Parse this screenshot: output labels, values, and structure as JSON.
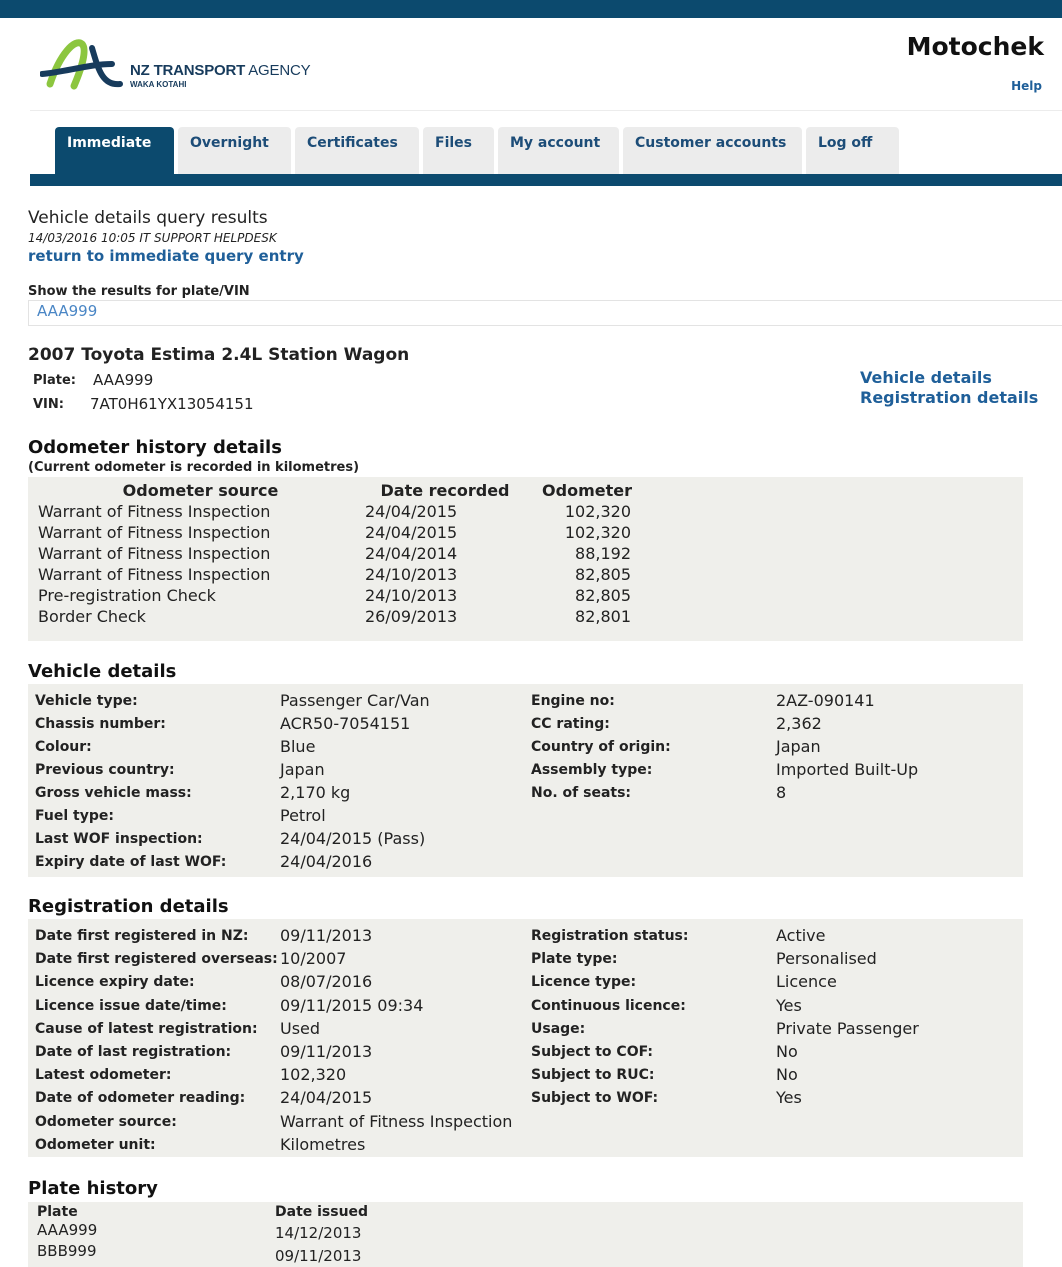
{
  "header": {
    "org_name_bold": "NZ TRANSPORT",
    "org_name_rest": " AGENCY",
    "org_sub": "WAKA KOTAHI",
    "app_name": "Motochek",
    "help": "Help"
  },
  "tabs": [
    {
      "label": "Immediate",
      "active": true
    },
    {
      "label": "Overnight"
    },
    {
      "label": "Certificates"
    },
    {
      "label": "Files"
    },
    {
      "label": "My account"
    },
    {
      "label": "Customer accounts"
    },
    {
      "label": "Log off"
    }
  ],
  "query": {
    "title": "Vehicle details query results",
    "subtitle": "14/03/2016 10:05 IT SUPPORT HELPDESK",
    "return_link": "return to immediate query entry",
    "show_label": "Show the results for plate/VIN",
    "plate_value": "AAA999"
  },
  "vehicle": {
    "title": "2007 Toyota Estima 2.4L Station Wagon",
    "plate_label": "Plate:",
    "plate": "AAA999",
    "vin_label": "VIN:",
    "vin": "7AT0H61YX13054151",
    "link_vehicle": "Vehicle details",
    "link_registration": "Registration details"
  },
  "odometer": {
    "title": "Odometer history details",
    "note": "(Current odometer is recorded in kilometres)",
    "headers": [
      "Odometer source",
      "Date recorded",
      "Odometer"
    ],
    "rows": [
      [
        "Warrant of Fitness Inspection",
        "24/04/2015",
        "102,320"
      ],
      [
        "Warrant of Fitness Inspection",
        "24/04/2015",
        "102,320"
      ],
      [
        "Warrant of Fitness Inspection",
        "24/04/2014",
        "88,192"
      ],
      [
        "Warrant of Fitness Inspection",
        "24/10/2013",
        "82,805"
      ],
      [
        "Pre-registration Check",
        "24/10/2013",
        "82,805"
      ],
      [
        "Border Check",
        "26/09/2013",
        "82,801"
      ]
    ]
  },
  "vehicle_details": {
    "title": "Vehicle details",
    "left": [
      [
        "Vehicle type:",
        "Passenger Car/Van"
      ],
      [
        "Chassis number:",
        "ACR50-7054151"
      ],
      [
        "Colour:",
        "Blue"
      ],
      [
        "Previous country:",
        "Japan"
      ],
      [
        "Gross vehicle mass:",
        "2,170 kg"
      ],
      [
        "Fuel type:",
        "Petrol"
      ],
      [
        "Last WOF inspection:",
        "24/04/2015 (Pass)"
      ],
      [
        "Expiry date of last WOF:",
        "24/04/2016"
      ]
    ],
    "right": [
      [
        "Engine no:",
        "2AZ-090141"
      ],
      [
        "CC rating:",
        "2,362"
      ],
      [
        "Country of origin:",
        "Japan"
      ],
      [
        "Assembly type:",
        "Imported Built-Up"
      ],
      [
        "No. of seats:",
        "8"
      ]
    ]
  },
  "registration_details": {
    "title": "Registration details",
    "left": [
      [
        "Date first registered in NZ:",
        "09/11/2013"
      ],
      [
        "Date first registered overseas:",
        "10/2007"
      ],
      [
        "Licence expiry date:",
        "08/07/2016"
      ],
      [
        "Licence issue date/time:",
        "09/11/2015 09:34"
      ],
      [
        "Cause of latest registration:",
        "Used"
      ],
      [
        "Date of last registration:",
        "09/11/2013"
      ],
      [
        "Latest odometer:",
        "102,320"
      ],
      [
        "Date of odometer reading:",
        "24/04/2015"
      ],
      [
        "Odometer source:",
        "Warrant of Fitness Inspection"
      ],
      [
        "Odometer unit:",
        "Kilometres"
      ]
    ],
    "right": [
      [
        "Registration status:",
        "Active"
      ],
      [
        "Plate type:",
        "Personalised"
      ],
      [
        "Licence type:",
        "Licence"
      ],
      [
        "Continuous licence:",
        "Yes"
      ],
      [
        "Usage:",
        "Private Passenger"
      ],
      [
        "Subject to COF:",
        "No"
      ],
      [
        "Subject to RUC:",
        "No"
      ],
      [
        "Subject to WOF:",
        "Yes"
      ]
    ]
  },
  "plate_history": {
    "title": "Plate history",
    "headers": [
      "Plate",
      "Date issued"
    ],
    "rows": [
      [
        "AAA999",
        "14/12/2013"
      ],
      [
        "BBB999",
        "09/11/2013"
      ]
    ]
  },
  "colors": {
    "navy": "#0c4a6e",
    "link": "#1f5f99",
    "logo_green": "#8cc63f",
    "panel": "#efefeb"
  }
}
